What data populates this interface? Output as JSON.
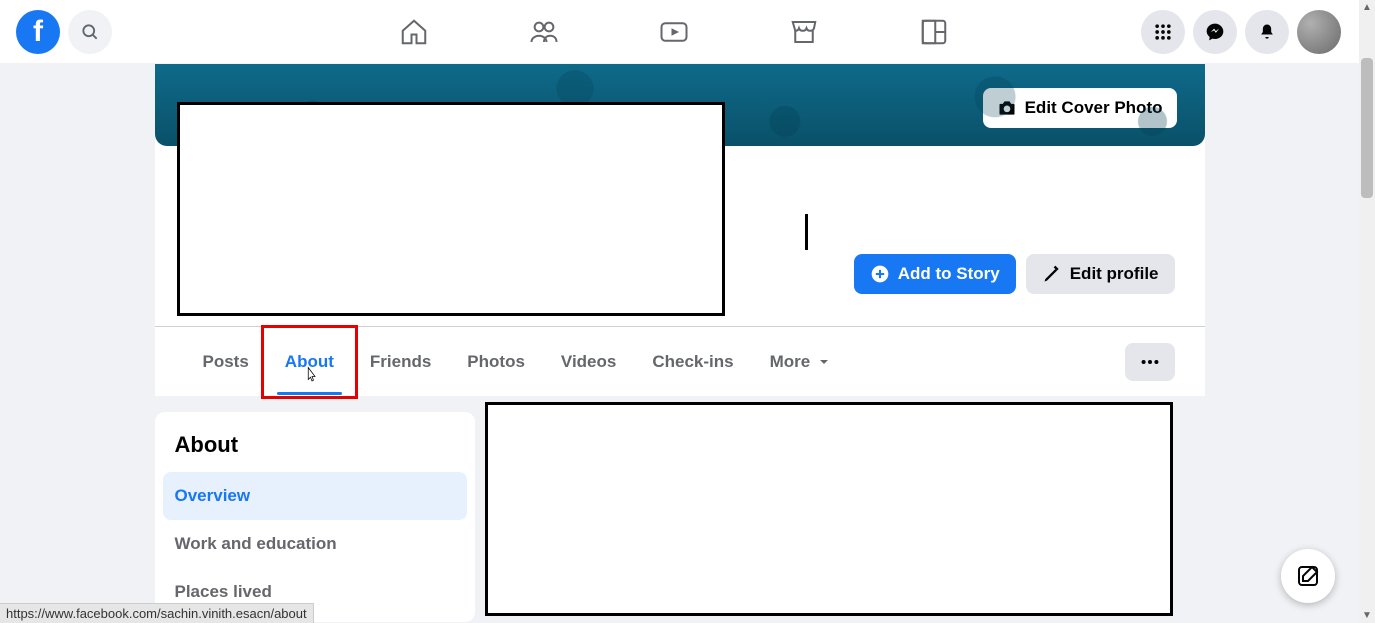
{
  "topnav": {
    "icons": {
      "home": "home-icon",
      "friends": "friends-icon",
      "watch": "watch-icon",
      "marketplace": "marketplace-icon",
      "groups": "groups-icon",
      "menu": "menu-icon",
      "messenger": "messenger-icon",
      "notifications": "notifications-icon"
    }
  },
  "cover": {
    "edit_label": "Edit Cover Photo"
  },
  "profile_actions": {
    "add_story": "Add to Story",
    "edit_profile": "Edit profile"
  },
  "tabs": {
    "posts": "Posts",
    "about": "About",
    "friends": "Friends",
    "photos": "Photos",
    "videos": "Videos",
    "checkins": "Check-ins",
    "more": "More"
  },
  "about": {
    "title": "About",
    "items": {
      "overview": "Overview",
      "work_education": "Work and education",
      "places_lived": "Places lived"
    }
  },
  "status_url": "https://www.facebook.com/sachin.vinith.esacn/about"
}
